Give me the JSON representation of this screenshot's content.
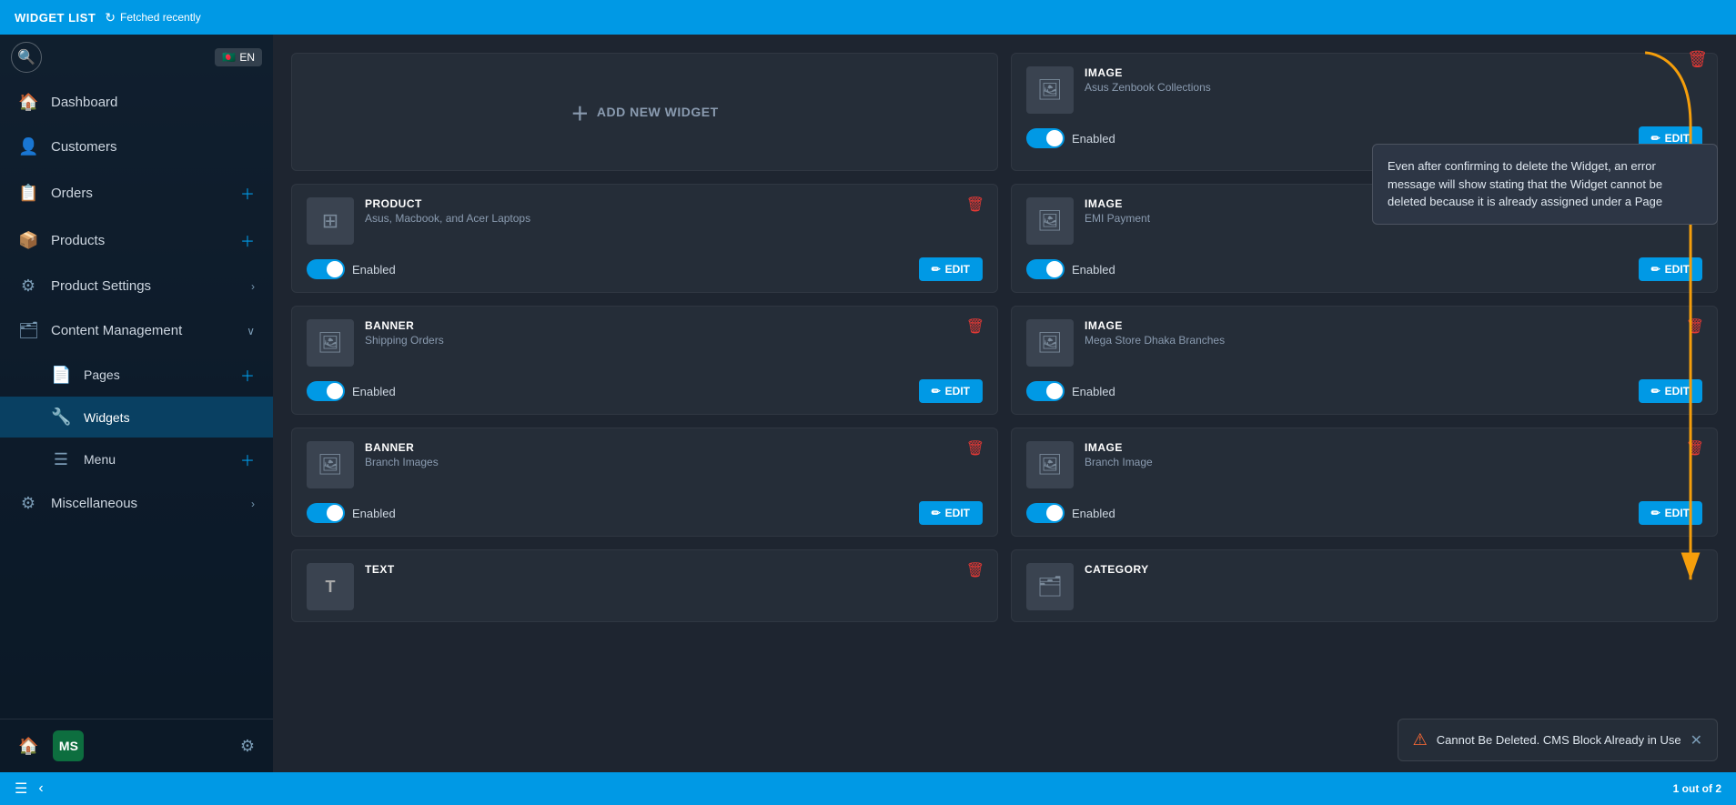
{
  "topbar": {
    "title": "WIDGET LIST",
    "fetched_label": "Fetched recently"
  },
  "sidebar": {
    "lang": "EN",
    "nav_items": [
      {
        "id": "dashboard",
        "label": "Dashboard",
        "icon": "🏠",
        "has_arrow": false,
        "has_plus": false
      },
      {
        "id": "customers",
        "label": "Customers",
        "icon": "👤",
        "has_arrow": false,
        "has_plus": false
      },
      {
        "id": "orders",
        "label": "Orders",
        "icon": "📋",
        "has_arrow": false,
        "has_plus": true
      },
      {
        "id": "products",
        "label": "Products",
        "icon": "📦",
        "has_arrow": false,
        "has_plus": true
      },
      {
        "id": "product-settings",
        "label": "Product Settings",
        "icon": "⚙",
        "has_arrow": true,
        "has_plus": false
      },
      {
        "id": "content-management",
        "label": "Content Management",
        "icon": "🗂",
        "has_arrow": true,
        "has_plus": false,
        "expanded": true
      }
    ],
    "sub_items": [
      {
        "id": "pages",
        "label": "Pages",
        "icon": "📄",
        "has_plus": true
      },
      {
        "id": "widgets",
        "label": "Widgets",
        "icon": "🔧",
        "has_plus": false,
        "active": true
      },
      {
        "id": "menu",
        "label": "Menu",
        "icon": "☰",
        "has_plus": true
      }
    ],
    "misc_item": {
      "label": "Miscellaneous",
      "icon": "⚙",
      "has_arrow": true
    }
  },
  "add_widget": {
    "label": "ADD NEW WIDGET"
  },
  "widgets": [
    {
      "id": "top-right-image",
      "type": "IMAGE",
      "name": "Asus Zenbook Collections",
      "enabled": true,
      "position": "top-right"
    },
    {
      "id": "widget-product",
      "type": "PRODUCT",
      "name": "Asus, Macbook, and Acer Laptops",
      "enabled": true
    },
    {
      "id": "widget-image-emi",
      "type": "IMAGE",
      "name": "EMI Payment",
      "enabled": true
    },
    {
      "id": "widget-banner-shipping",
      "type": "BANNER",
      "name": "Shipping Orders",
      "enabled": true
    },
    {
      "id": "widget-image-mega",
      "type": "IMAGE",
      "name": "Mega Store Dhaka Branches",
      "enabled": true
    },
    {
      "id": "widget-banner-branch",
      "type": "BANNER",
      "name": "Branch Images",
      "enabled": true
    },
    {
      "id": "widget-image-branch",
      "type": "IMAGE",
      "name": "Branch Image",
      "enabled": true
    },
    {
      "id": "widget-text",
      "type": "TEXT",
      "name": "...",
      "enabled": true
    },
    {
      "id": "widget-category",
      "type": "CATEGORY",
      "name": "...",
      "enabled": true
    }
  ],
  "annotation": {
    "text": "Even after confirming to delete the Widget, an error message will show stating that the Widget cannot be deleted because it is already assigned under a Page"
  },
  "buttons": {
    "edit_label": "EDIT"
  },
  "toast": {
    "message": "Cannot Be Deleted. CMS Block Already in Use",
    "icon": "⚠"
  },
  "bottombar": {
    "page_info": "1  out of 2"
  }
}
